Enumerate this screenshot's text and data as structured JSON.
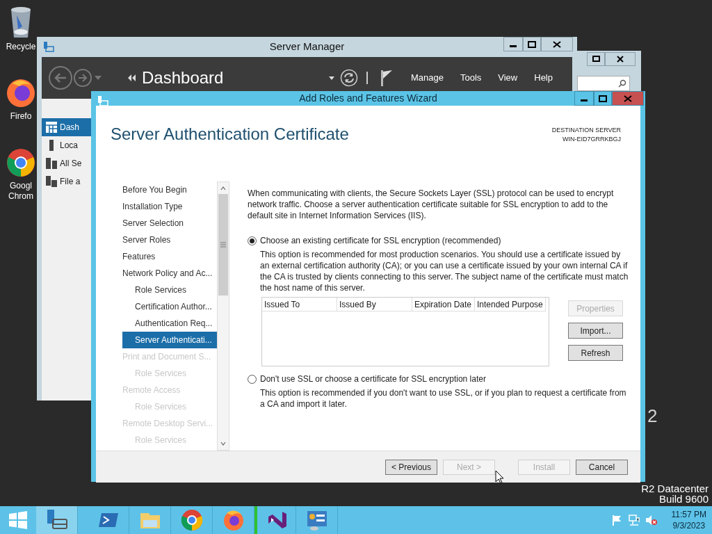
{
  "desktop": {
    "icons": [
      {
        "kind": "recycle",
        "label": "Recycle"
      },
      {
        "kind": "firefox",
        "label": "Firefo"
      },
      {
        "kind": "chrome",
        "label": "Googl Chrom"
      }
    ],
    "watermark": [
      "2",
      "R2 Datacenter",
      "Build 9600"
    ]
  },
  "server_manager": {
    "title": "Server Manager",
    "page": "Dashboard",
    "menus": [
      "Manage",
      "Tools",
      "View",
      "Help"
    ],
    "sidebar": [
      {
        "label": "Dash",
        "selected": true
      },
      {
        "label": "Loca",
        "selected": false
      },
      {
        "label": "All Se",
        "selected": false
      },
      {
        "label": "File a",
        "selected": false
      }
    ]
  },
  "wizard": {
    "title": "Add Roles and Features Wizard",
    "heading": "Server Authentication Certificate",
    "destination_label": "DESTINATION SERVER",
    "destination": "WIN-EID7GRRKBGJ",
    "nav": [
      {
        "label": "Before You Begin",
        "selected": false,
        "disabled": false
      },
      {
        "label": "Installation Type",
        "selected": false,
        "disabled": false
      },
      {
        "label": "Server Selection",
        "selected": false,
        "disabled": false
      },
      {
        "label": "Server Roles",
        "selected": false,
        "disabled": false
      },
      {
        "label": "Features",
        "selected": false,
        "disabled": false
      },
      {
        "label": "Network Policy and Ac...",
        "selected": false,
        "disabled": false,
        "children": [
          {
            "label": "Role Services",
            "selected": false,
            "disabled": false
          },
          {
            "label": "Certification Author...",
            "selected": false,
            "disabled": false
          },
          {
            "label": "Authentication Req...",
            "selected": false,
            "disabled": false
          },
          {
            "label": "Server Authenticati...",
            "selected": true,
            "disabled": false
          }
        ]
      },
      {
        "label": "Print and Document S...",
        "selected": false,
        "disabled": true,
        "children": [
          {
            "label": "Role Services",
            "selected": false,
            "disabled": true
          }
        ]
      },
      {
        "label": "Remote Access",
        "selected": false,
        "disabled": true,
        "children": [
          {
            "label": "Role Services",
            "selected": false,
            "disabled": true
          }
        ]
      },
      {
        "label": "Remote Desktop Servi...",
        "selected": false,
        "disabled": true,
        "children": [
          {
            "label": "Role Services",
            "selected": false,
            "disabled": true
          }
        ]
      }
    ],
    "intro": "When communicating with clients, the Secure Sockets Layer (SSL) protocol can be used to encrypt network traffic. Choose a server authentication certificate suitable for SSL encryption to add to the default site in Internet Information Services (IIS).",
    "options": [
      {
        "label": "Choose an existing certificate for SSL encryption (recommended)",
        "selected": true,
        "description": "This option is recommended for most production scenarios. You should use a certificate issued by an external certification authority (CA); or you can use a certificate issued by your own internal CA if the CA is trusted by clients connecting to this server. The subject name of the certificate must match the host name of this server.",
        "has_table": true
      },
      {
        "label": "Don't use SSL or choose a certificate for SSL encryption later",
        "selected": false,
        "description": "This option is recommended if you don't want to use SSL, or if you plan to request a certificate from a CA and import it later.",
        "has_table": false
      }
    ],
    "table": {
      "columns": [
        "Issued To",
        "Issued By",
        "Expiration Date",
        "Intended Purpose"
      ]
    },
    "side_buttons": [
      {
        "label": "Properties",
        "disabled": true
      },
      {
        "label": "Import...",
        "disabled": false
      },
      {
        "label": "Refresh",
        "disabled": false
      }
    ],
    "footer_buttons": [
      {
        "label": "< Previous",
        "disabled": false
      },
      {
        "label": "Next >",
        "disabled": true
      },
      {
        "label": "Install",
        "disabled": true
      },
      {
        "label": "Cancel",
        "disabled": false
      }
    ]
  },
  "taskbar": {
    "apps": [
      {
        "kind": "server-manager",
        "active": true
      },
      {
        "kind": "powershell",
        "active": false
      },
      {
        "kind": "explorer",
        "active": false
      },
      {
        "kind": "chrome",
        "active": false
      },
      {
        "kind": "firefox",
        "active": false
      },
      {
        "kind": "visual-studio",
        "active": false
      },
      {
        "kind": "control-panel",
        "active": false
      }
    ],
    "time": "11:57 PM",
    "date": "9/3/2023"
  }
}
